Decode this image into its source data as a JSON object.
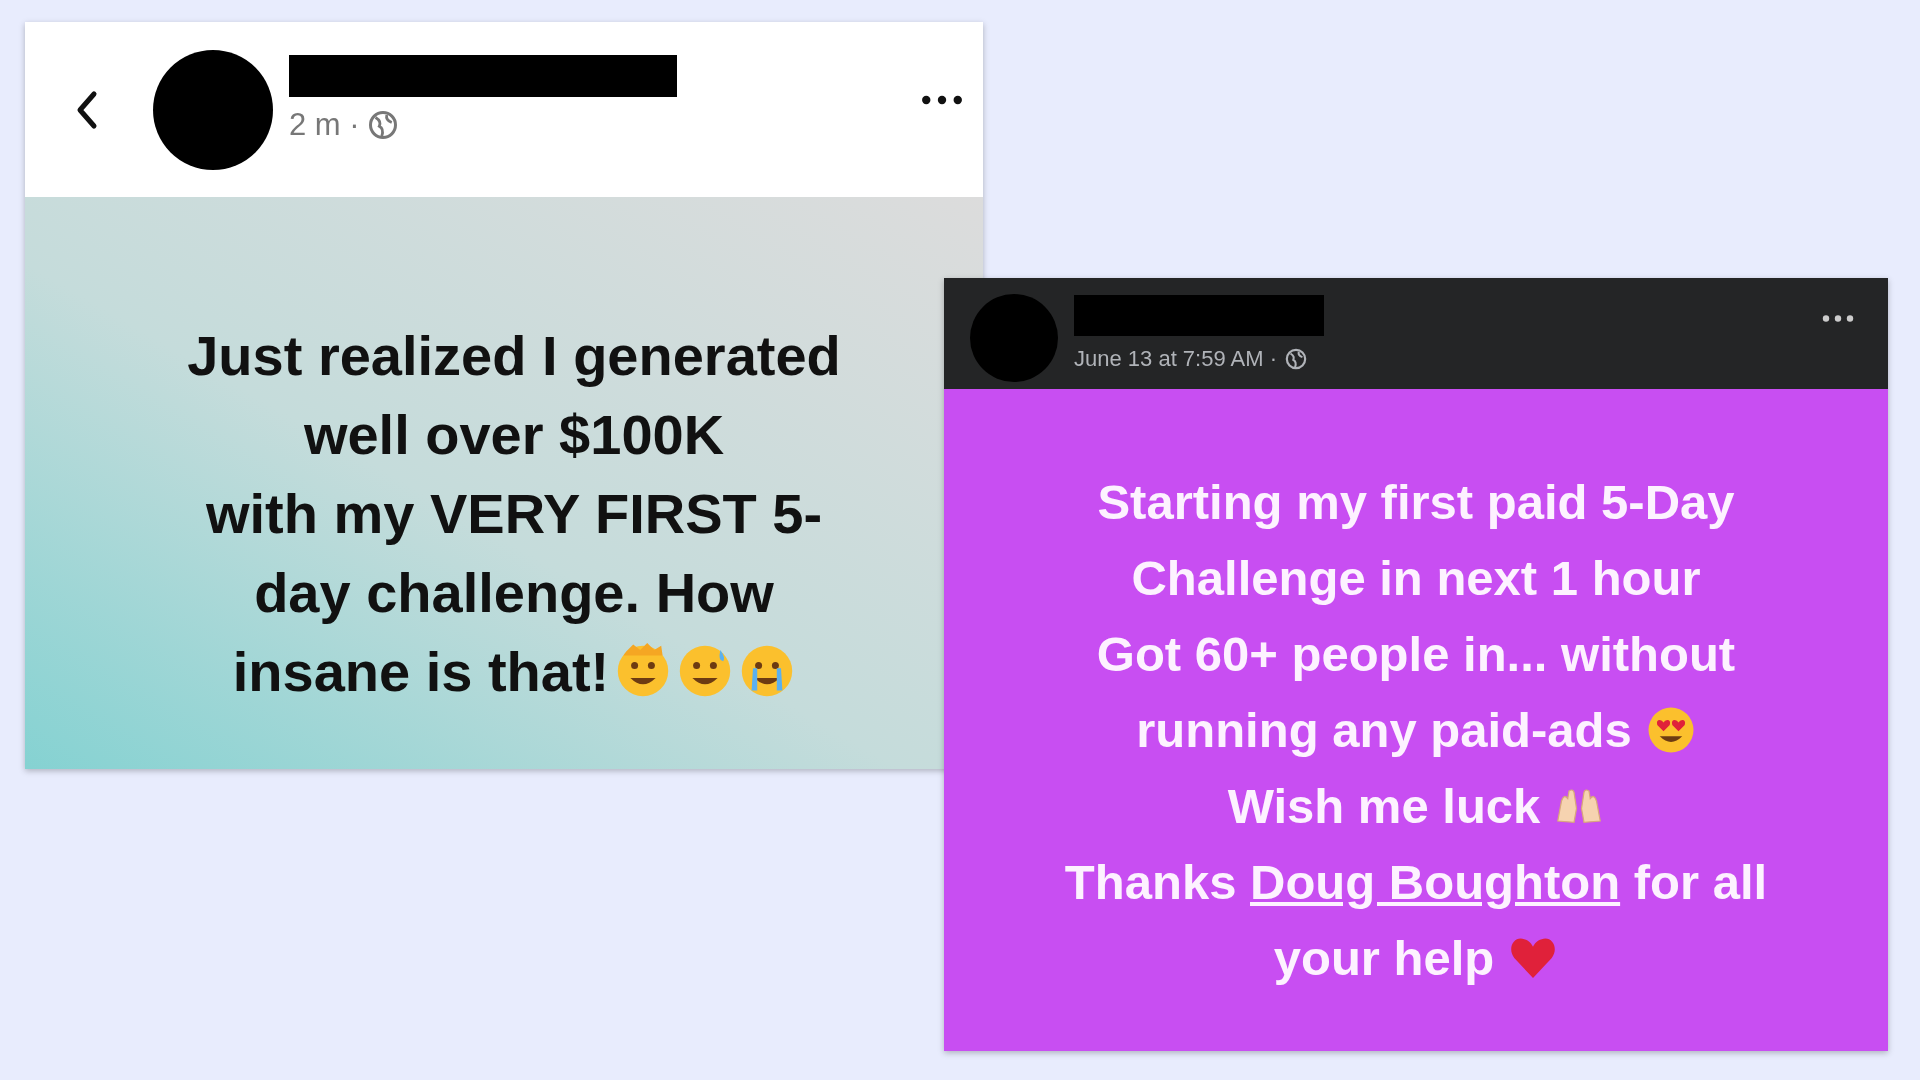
{
  "posts": [
    {
      "kind": "light",
      "time": "2 m ·",
      "lines": [
        {
          "text": "Just realized I generated"
        },
        {
          "text": "well over $100K"
        },
        {
          "text": "with my VERY FIRST 5-"
        },
        {
          "text": "day challenge. How"
        },
        {
          "text": "insane is that!"
        }
      ]
    },
    {
      "kind": "dark",
      "time": "June 13 at 7:59 AM ·",
      "lines": [
        {
          "text": "Starting my first paid 5-Day"
        },
        {
          "text": "Challenge in next 1 hour"
        },
        {
          "text": "Got 60+ people in... without"
        },
        {
          "text": "running any paid-ads"
        },
        {
          "text": "Wish me luck"
        },
        {
          "text": "Thanks",
          "link": "Doug Boughton",
          "after": "for all"
        },
        {
          "text": "your help"
        }
      ]
    }
  ]
}
